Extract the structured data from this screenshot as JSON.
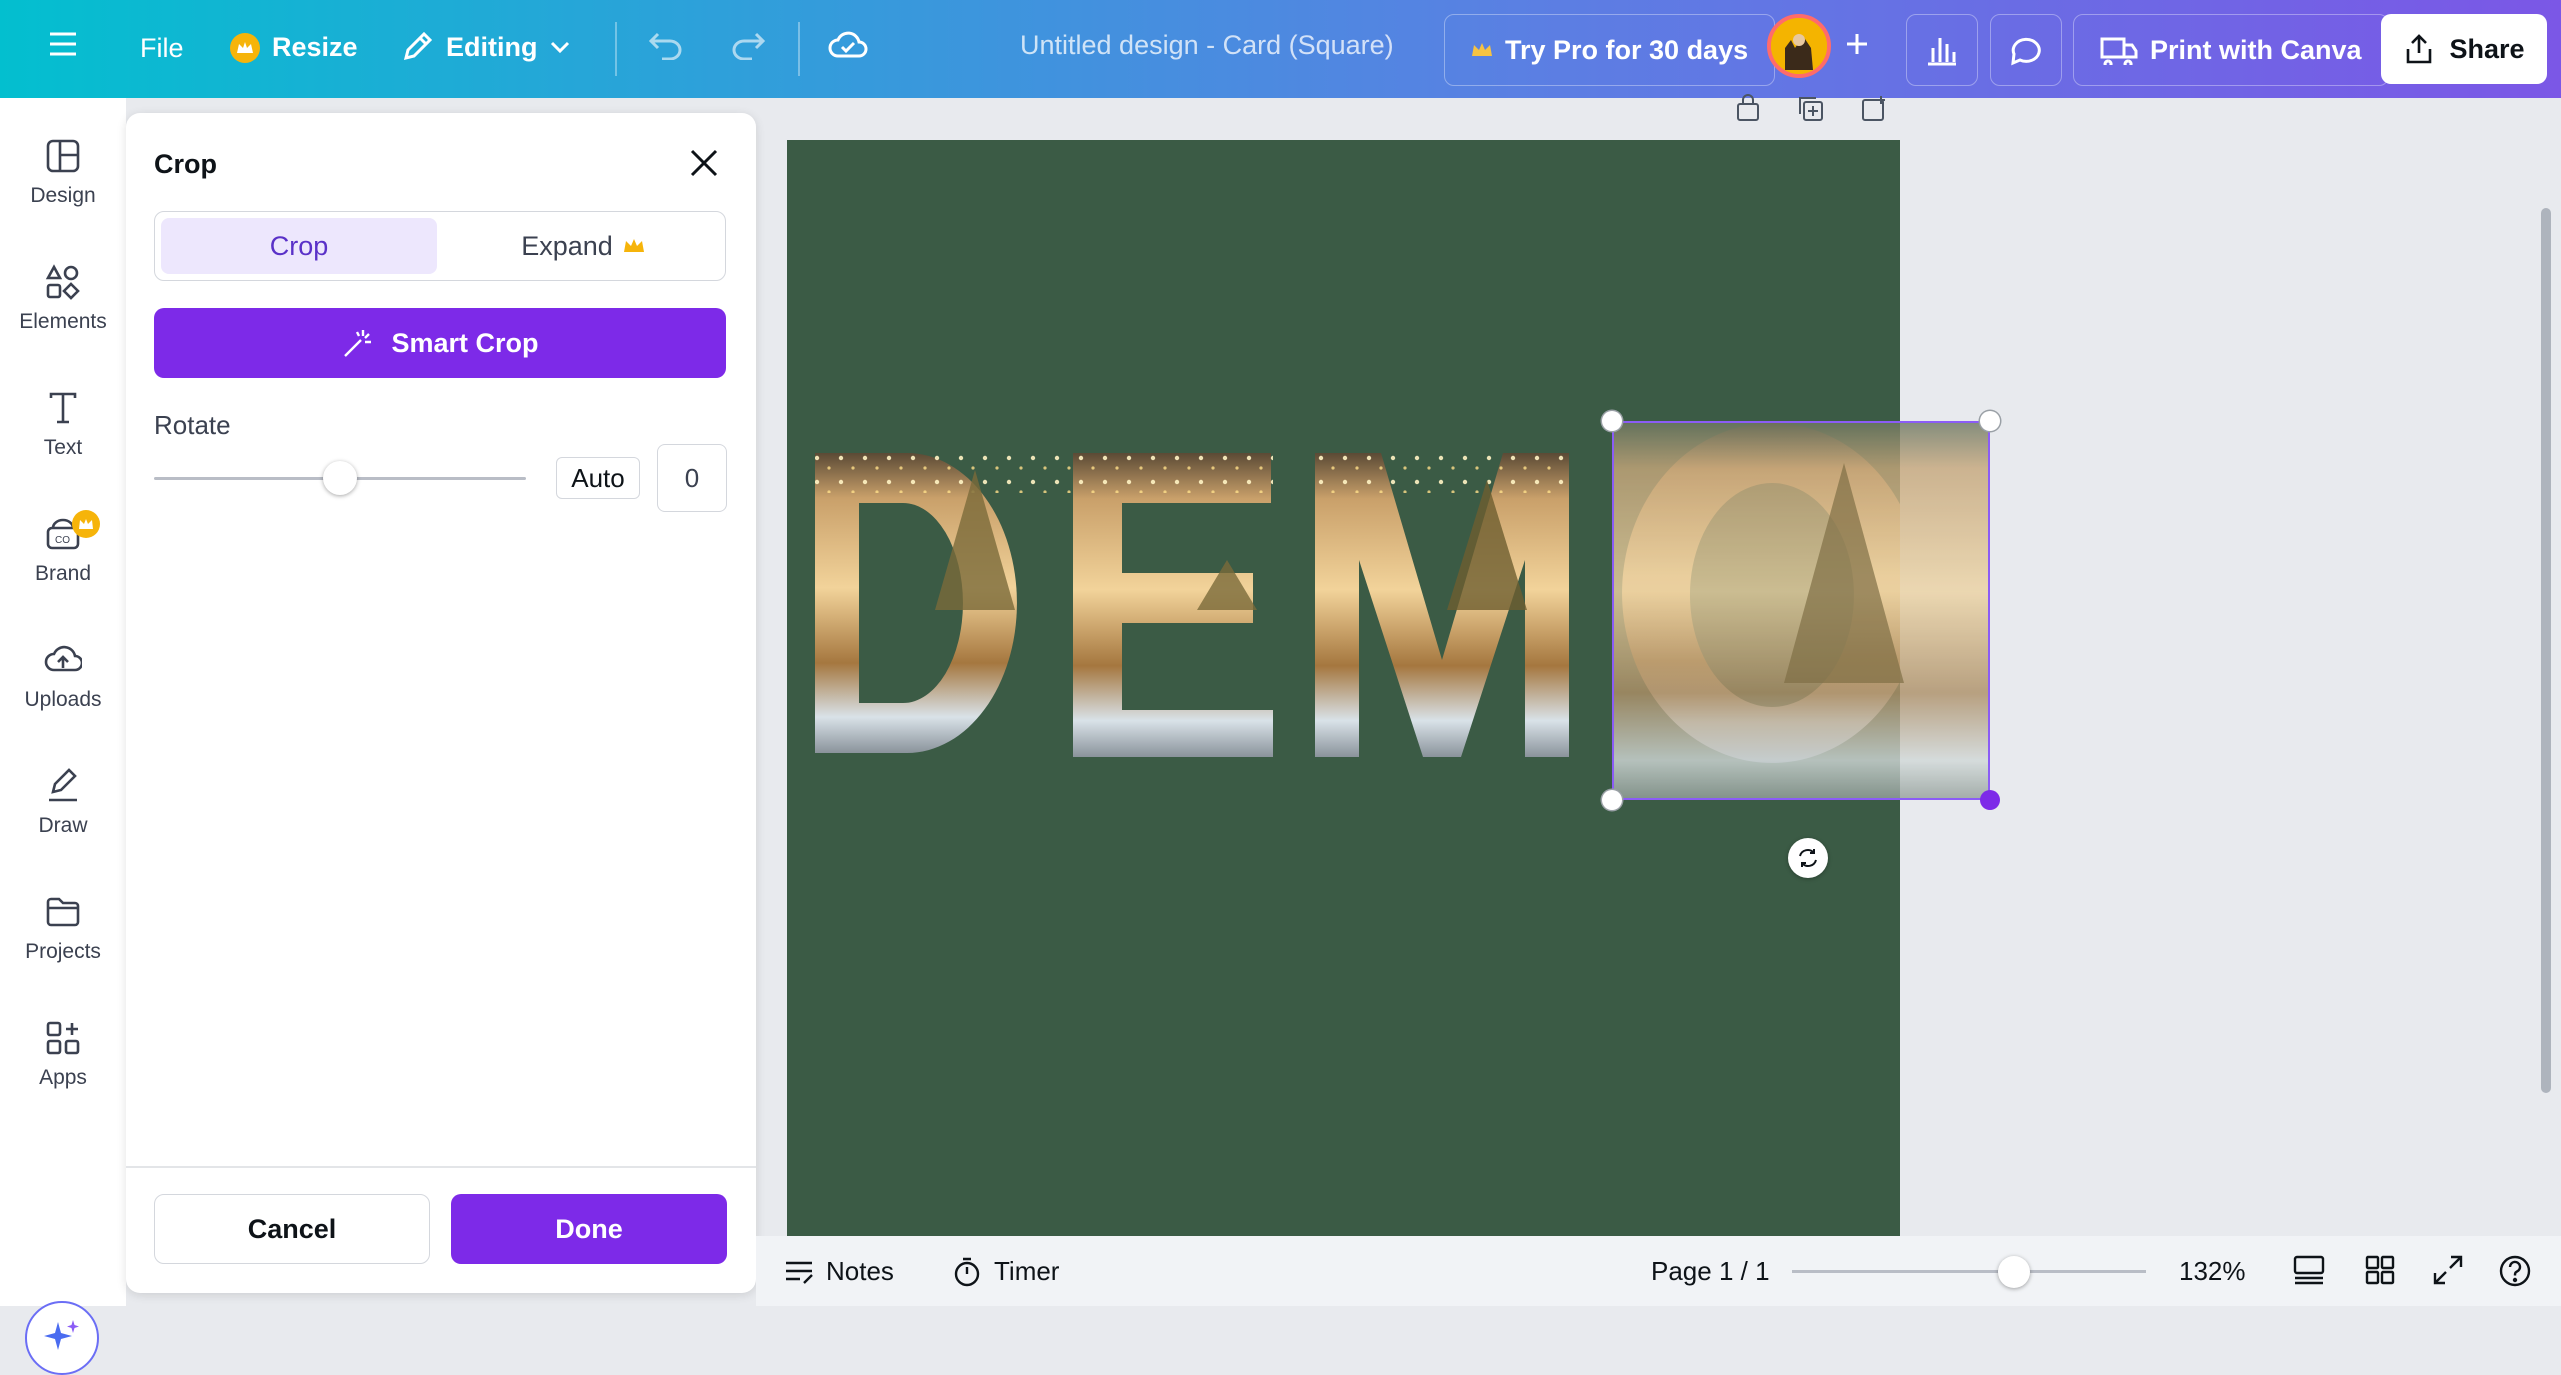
{
  "topbar": {
    "file_label": "File",
    "resize_label": "Resize",
    "editing_label": "Editing",
    "doc_title": "Untitled design - Card (Square)",
    "try_pro_label": "Try Pro for 30 days",
    "print_label": "Print with Canva",
    "share_label": "Share"
  },
  "rail": {
    "items": [
      {
        "label": "Design",
        "icon": "design-icon"
      },
      {
        "label": "Elements",
        "icon": "elements-icon"
      },
      {
        "label": "Text",
        "icon": "text-icon"
      },
      {
        "label": "Brand",
        "icon": "brand-icon"
      },
      {
        "label": "Uploads",
        "icon": "uploads-icon"
      },
      {
        "label": "Draw",
        "icon": "draw-icon"
      },
      {
        "label": "Projects",
        "icon": "projects-icon"
      },
      {
        "label": "Apps",
        "icon": "apps-icon"
      }
    ]
  },
  "crop_panel": {
    "title": "Crop",
    "tabs": {
      "crop": "Crop",
      "expand": "Expand"
    },
    "smart_crop_label": "Smart Crop",
    "rotate_label": "Rotate",
    "rotate_auto_label": "Auto",
    "rotate_value": "0",
    "rotate_slider_fraction": 0.5,
    "cancel_label": "Cancel",
    "done_label": "Done"
  },
  "canvas": {
    "background_color": "#3b5b45",
    "letters": [
      "D",
      "E",
      "M",
      "O"
    ]
  },
  "bottom_bar": {
    "notes_label": "Notes",
    "timer_label": "Timer",
    "page_label": "Page 1 / 1",
    "zoom_label": "132%"
  },
  "colors": {
    "accent_purple": "#7d2ae8",
    "gradient_start": "#03bfcf",
    "gradient_end": "#7b57e6",
    "crown_gold": "#f6b40a"
  }
}
